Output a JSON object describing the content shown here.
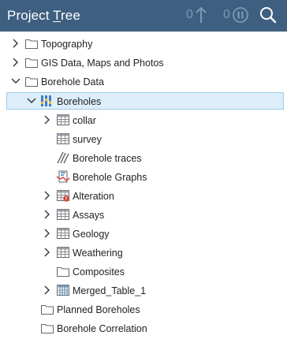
{
  "header": {
    "title_prefix": "Project ",
    "title_underlined": "T",
    "title_suffix": "ree",
    "counter_up": "0",
    "counter_pause": "0",
    "icons": [
      "arrow-up-icon",
      "pause-icon",
      "search-icon"
    ]
  },
  "tree": {
    "items": [
      {
        "label": "Topography",
        "icon": "folder-icon",
        "expander": "collapsed"
      },
      {
        "label": "GIS Data, Maps and Photos",
        "icon": "folder-icon",
        "expander": "collapsed"
      },
      {
        "label": "Borehole Data",
        "icon": "folder-icon",
        "expander": "expanded"
      },
      {
        "label": "Boreholes",
        "icon": "boreholes-icon",
        "expander": "expanded",
        "selected": true
      },
      {
        "label": "collar",
        "icon": "table-icon",
        "expander": "collapsed"
      },
      {
        "label": "survey",
        "icon": "table-icon",
        "expander": "none"
      },
      {
        "label": "Borehole traces",
        "icon": "traces-icon",
        "expander": "none"
      },
      {
        "label": "Borehole Graphs",
        "icon": "graphs-icon",
        "expander": "none"
      },
      {
        "label": "Alteration",
        "icon": "table-error-icon",
        "expander": "collapsed"
      },
      {
        "label": "Assays",
        "icon": "table-icon",
        "expander": "collapsed"
      },
      {
        "label": "Geology",
        "icon": "table-icon",
        "expander": "collapsed"
      },
      {
        "label": "Weathering",
        "icon": "table-icon",
        "expander": "collapsed"
      },
      {
        "label": "Composites",
        "icon": "folder-icon",
        "expander": "none"
      },
      {
        "label": "Merged_Table_1",
        "icon": "merged-table-icon",
        "expander": "collapsed"
      },
      {
        "label": "Planned Boreholes",
        "icon": "folder-icon",
        "expander": "none"
      },
      {
        "label": "Borehole Correlation",
        "icon": "folder-icon",
        "expander": "none"
      }
    ]
  },
  "colors": {
    "header_bg": "#3e5f80",
    "header_muted": "#7f98b2",
    "selection_bg": "#ddeefa",
    "selection_border": "#9ccbea"
  }
}
